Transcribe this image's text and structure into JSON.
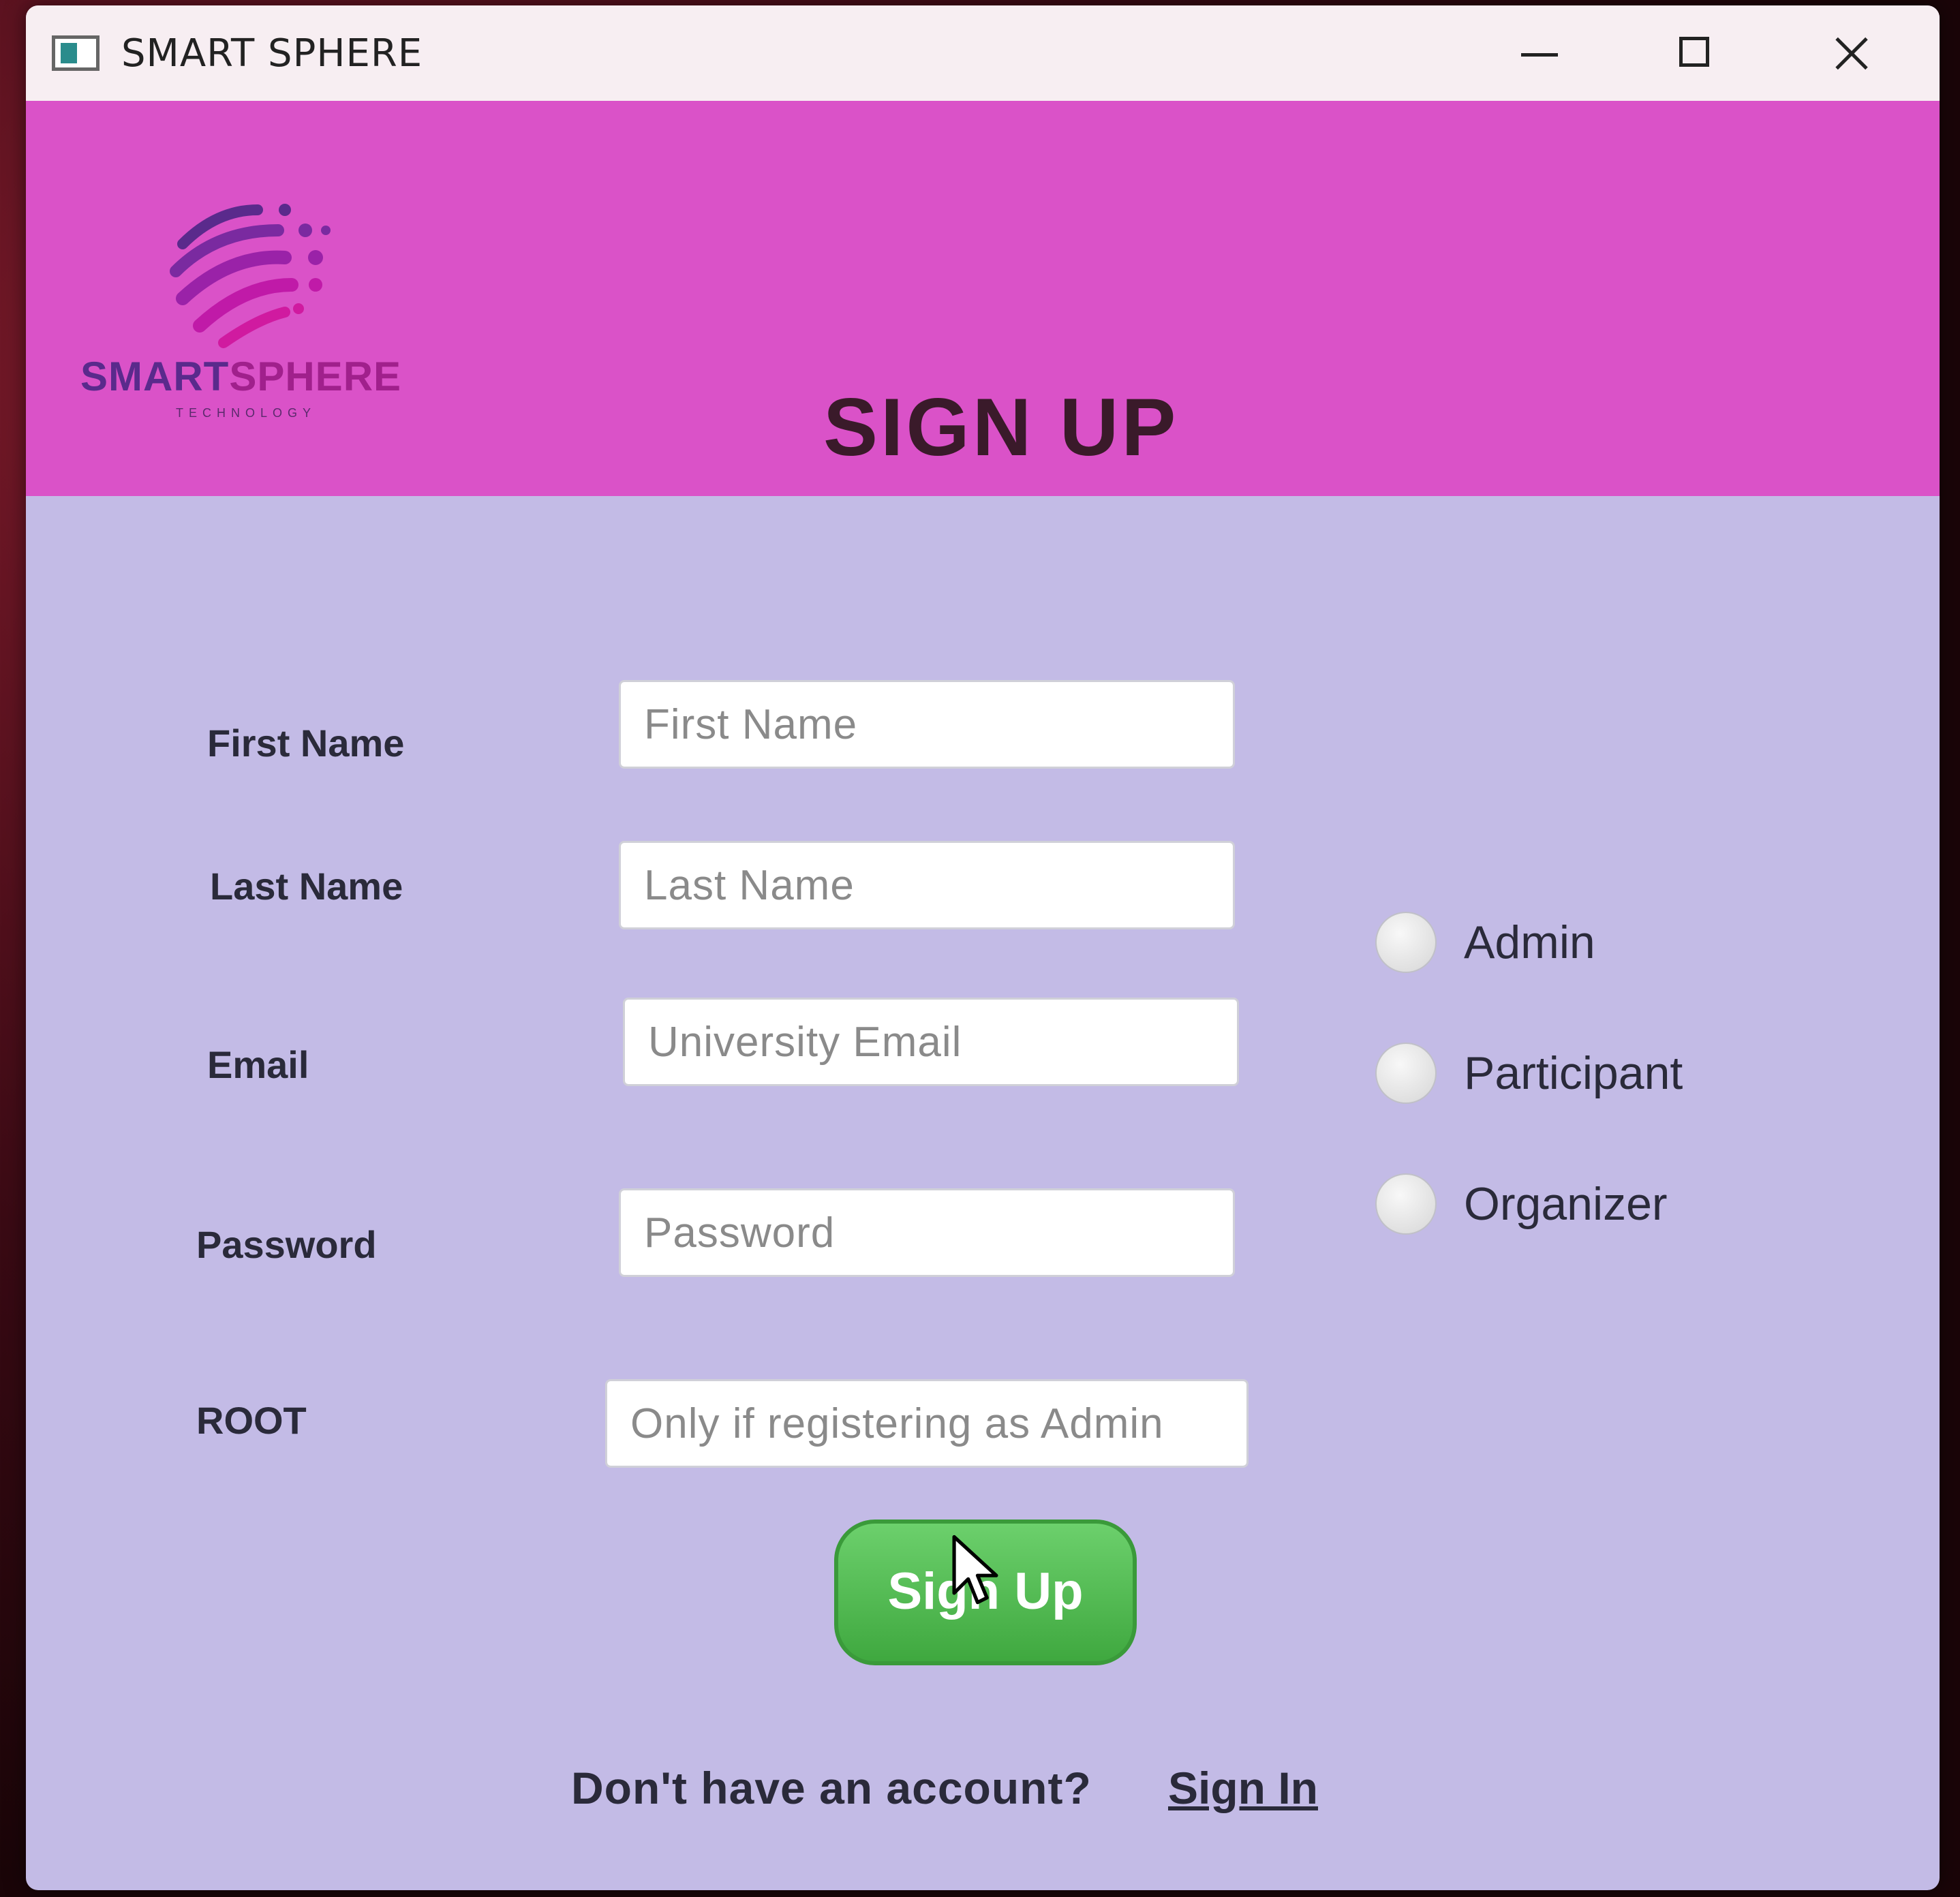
{
  "window": {
    "title": "SMART SPHERE",
    "minimize_icon": "minimize-icon",
    "maximize_icon": "maximize-icon",
    "close_icon": "close-icon"
  },
  "header": {
    "logo": {
      "brand_part1": "SMART",
      "brand_part2": "SPHERE",
      "subtitle": "TECHNOLOGY"
    },
    "title": "SIGN UP"
  },
  "form": {
    "first_name": {
      "label": "First Name",
      "placeholder": "First Name",
      "value": ""
    },
    "last_name": {
      "label": "Last Name",
      "placeholder": "Last Name",
      "value": ""
    },
    "email": {
      "label": "Email",
      "placeholder": "University Email",
      "value": ""
    },
    "password": {
      "label": "Password",
      "placeholder": "Password",
      "value": ""
    },
    "root": {
      "label": "ROOT",
      "placeholder": "Only if registering as Admin",
      "value": ""
    }
  },
  "roles": [
    {
      "label": "Admin",
      "selected": false
    },
    {
      "label": "Participant",
      "selected": false
    },
    {
      "label": "Organizer",
      "selected": false
    }
  ],
  "actions": {
    "signup_label": "Sign Up"
  },
  "footer": {
    "prompt": "Don't have an account?",
    "link": "Sign In"
  },
  "colors": {
    "header_bg": "#da52c8",
    "body_bg": "#c3bbe6",
    "button_green": "#4cb84c"
  }
}
